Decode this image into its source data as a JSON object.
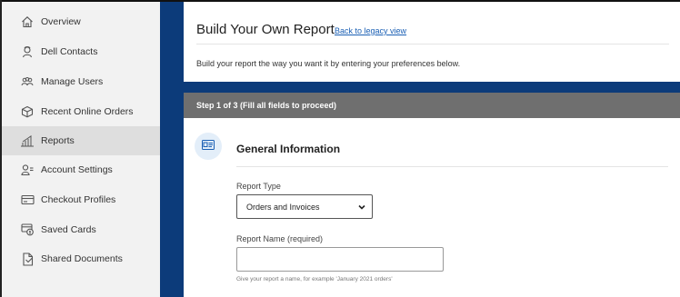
{
  "sidebar": {
    "items": [
      {
        "label": "Overview",
        "icon": "home-icon"
      },
      {
        "label": "Dell Contacts",
        "icon": "contact-icon"
      },
      {
        "label": "Manage Users",
        "icon": "users-icon"
      },
      {
        "label": "Recent Online Orders",
        "icon": "box-icon"
      },
      {
        "label": "Reports",
        "icon": "bar-chart-icon",
        "active": true
      },
      {
        "label": "Account Settings",
        "icon": "user-settings-icon"
      },
      {
        "label": "Checkout Profiles",
        "icon": "card-icon"
      },
      {
        "label": "Saved Cards",
        "icon": "saved-card-icon"
      },
      {
        "label": "Shared Documents",
        "icon": "document-icon"
      }
    ]
  },
  "header": {
    "title": "Build Your Own Report",
    "legacy_link": "Back to legacy view",
    "subtitle": "Build your report the way you want it by entering your preferences below."
  },
  "step": {
    "label": "Step 1 of 3 (Fill all fields to proceed)"
  },
  "section": {
    "title": "General Information",
    "icon": "id-card-icon"
  },
  "form": {
    "report_type_label": "Report Type",
    "report_type_value": "Orders and Invoices",
    "report_name_label": "Report Name (required)",
    "report_name_value": "",
    "report_name_placeholder": "",
    "report_name_hint": "Give your report a name, for example 'January 2021 orders'"
  },
  "colors": {
    "brand_blue": "#0c3b7a",
    "link_blue": "#1a5fb4",
    "step_bar": "#6f6f6f",
    "sidebar_bg": "#f2f2f2",
    "sidebar_active": "#dedede"
  }
}
